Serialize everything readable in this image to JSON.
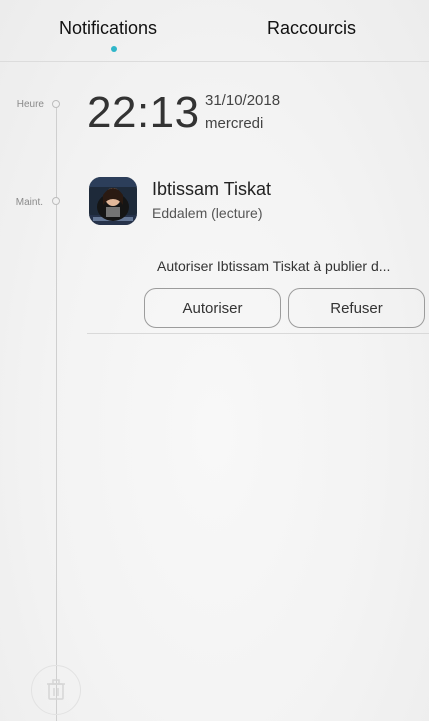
{
  "tabs": {
    "notifications": "Notifications",
    "shortcuts": "Raccourcis"
  },
  "timeline": {
    "time_label": "Heure",
    "now_label": "Maint."
  },
  "clock": {
    "time": "22:13",
    "date": "31/10/2018",
    "weekday": "mercredi"
  },
  "notification": {
    "title": "Ibtissam Tiskat",
    "subtitle": "Eddalem (lecture)",
    "message": "Autoriser Ibtissam Tiskat à publier d...",
    "allow_label": "Autoriser",
    "deny_label": "Refuser"
  },
  "colors": {
    "accent": "#2fb6c9"
  },
  "icons": {
    "trash": "trash-icon"
  }
}
